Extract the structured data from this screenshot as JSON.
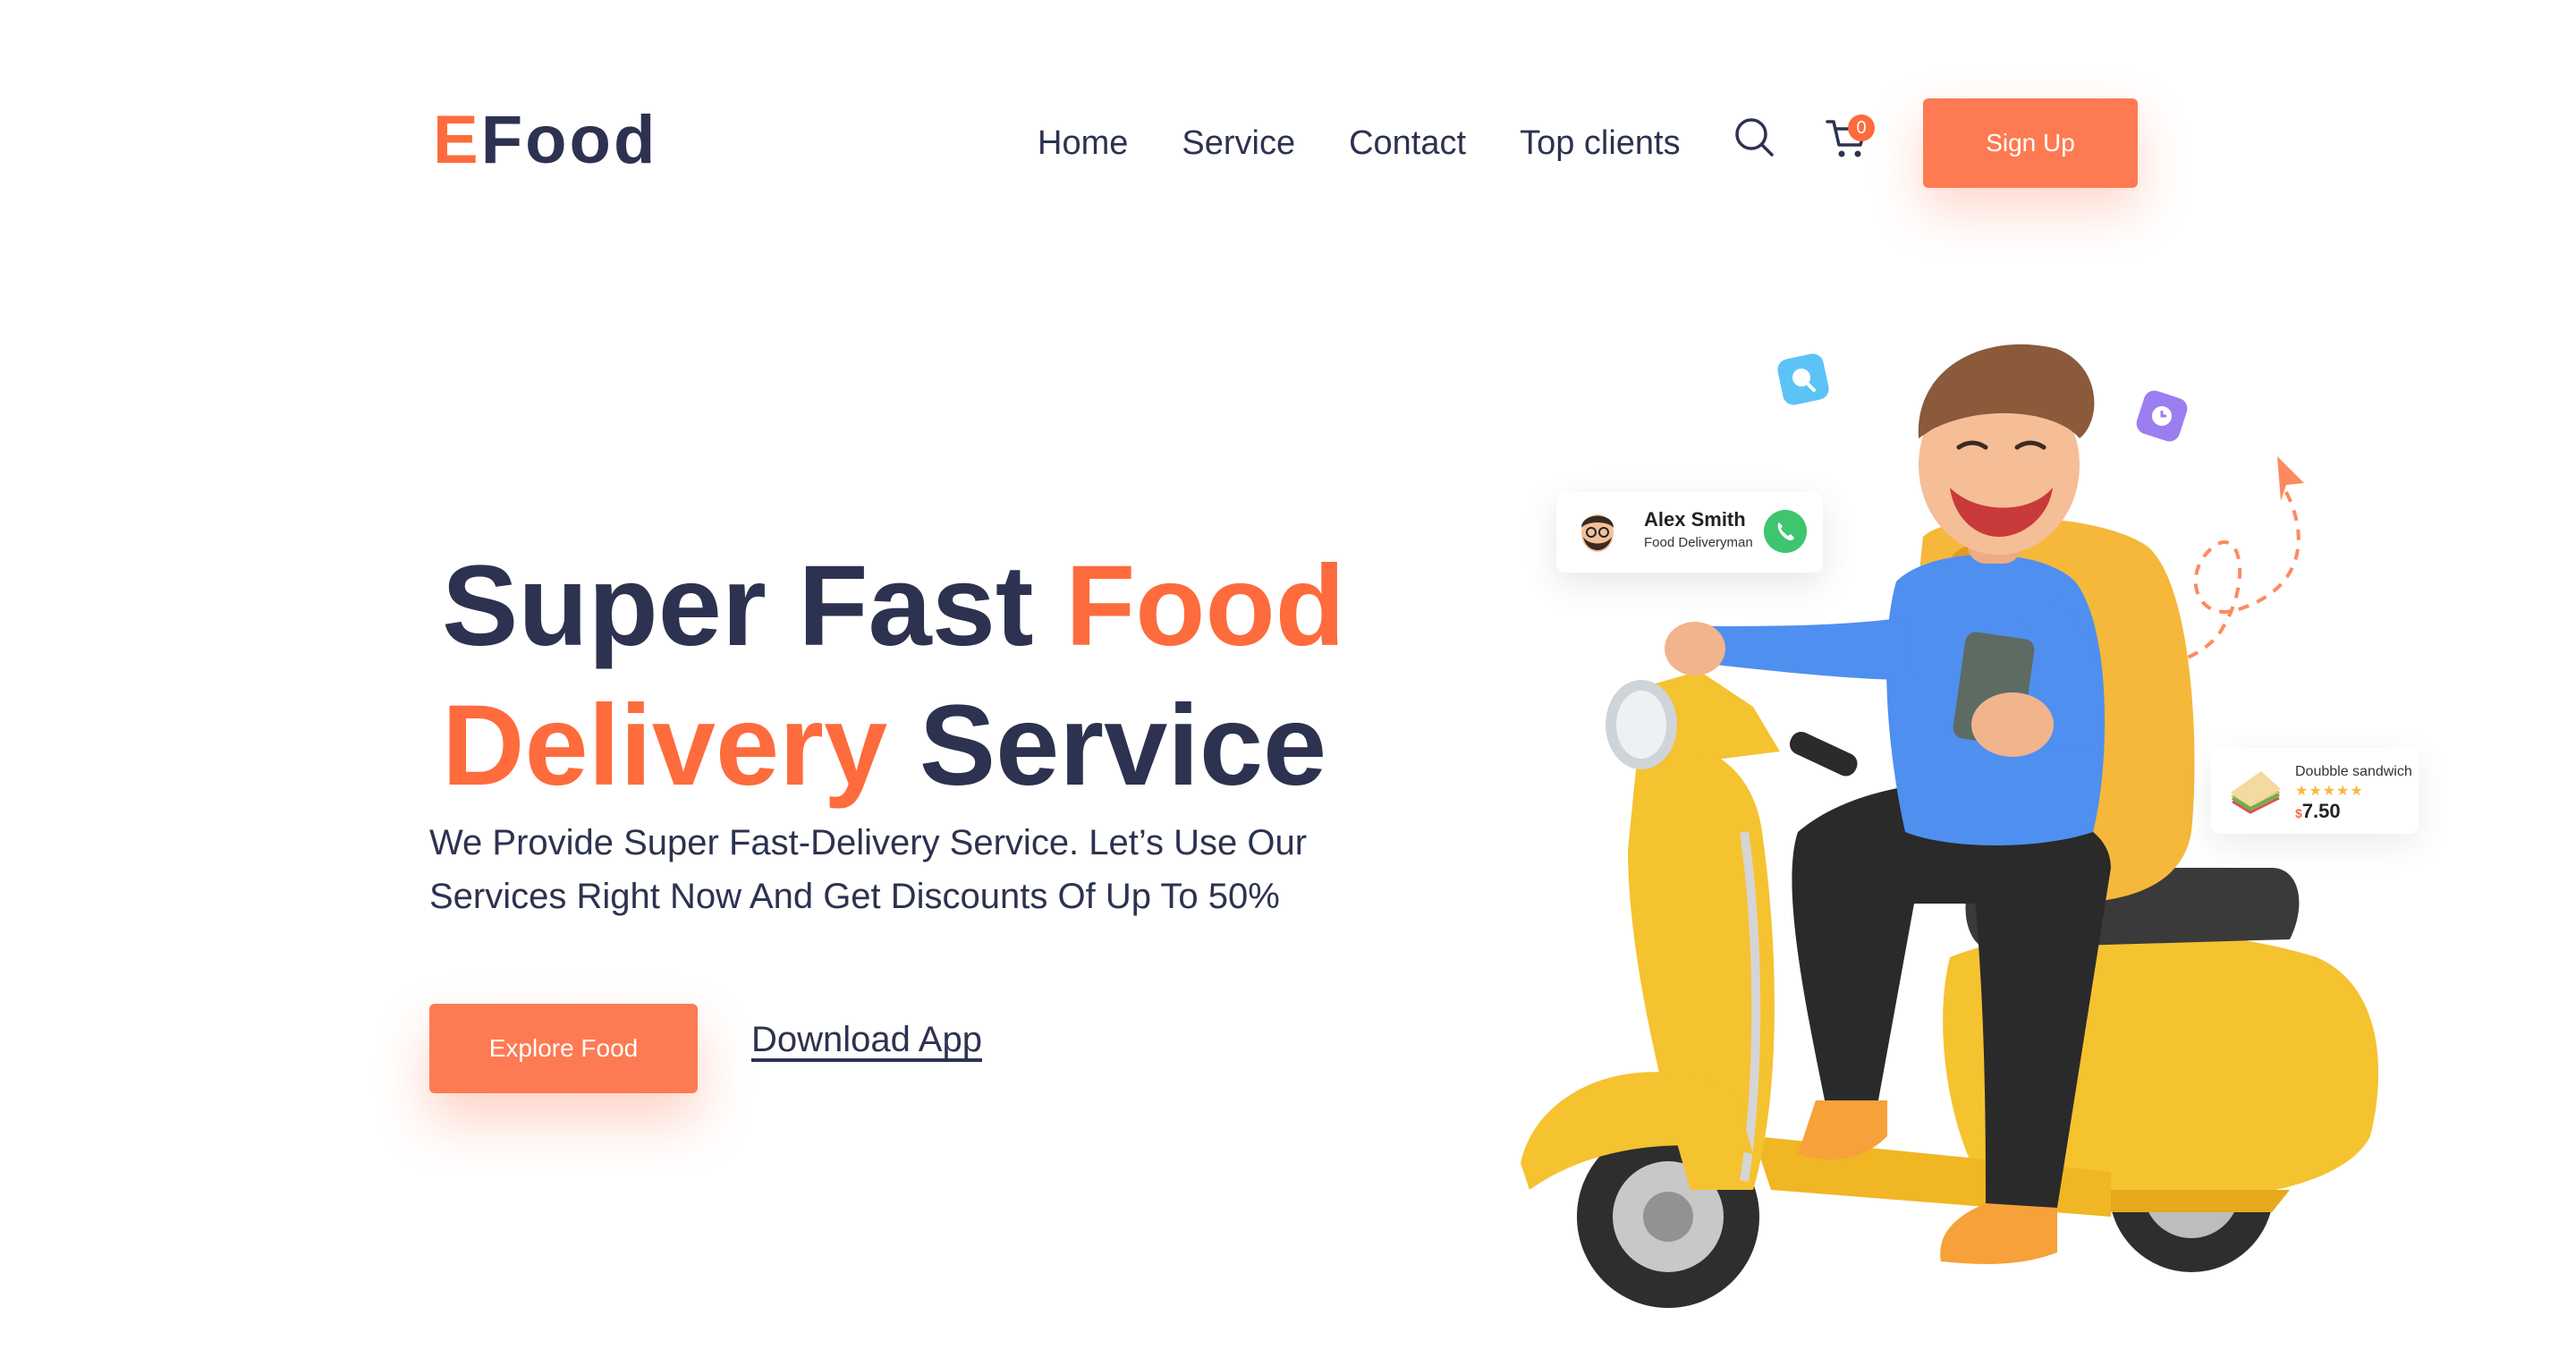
{
  "brand": {
    "logo_first": "E",
    "logo_rest": "Food",
    "accent_color": "#fe6b3d",
    "dark_color": "#2d3250"
  },
  "nav": {
    "items": [
      "Home",
      "Service",
      "Contact",
      "Top clients"
    ],
    "search_icon": "search-icon",
    "cart_icon": "cart-icon",
    "cart_count": "0",
    "signup_label": "Sign Up"
  },
  "hero": {
    "headline_part1": "Super Fast ",
    "headline_accent1": "Food",
    "headline_accent2": "Delivery",
    "headline_part2": " Service",
    "subtext": "We Provide Super Fast-Delivery Service. Let’s Use Our Services Right Now And Get Discounts Of Up To 50%",
    "explore_label": "Explore Food",
    "download_label": "Download App"
  },
  "driver_card": {
    "name": "Alex Smith",
    "role": "Food Deliveryman",
    "call_icon": "phone-icon"
  },
  "food_card": {
    "name": "Doubble sandwich",
    "rating": 5,
    "currency": "$",
    "price": "7.50"
  }
}
